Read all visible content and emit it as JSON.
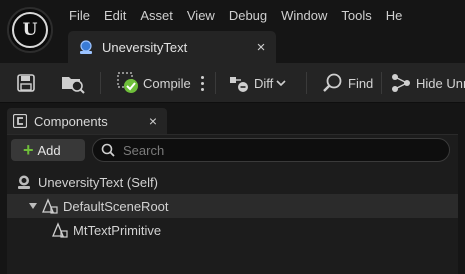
{
  "menu": {
    "items": [
      "File",
      "Edit",
      "Asset",
      "View",
      "Debug",
      "Window",
      "Tools",
      "He"
    ]
  },
  "document_tab": {
    "label": "UneversityText",
    "close": "×"
  },
  "toolbar": {
    "compile_label": "Compile",
    "diff_label": "Diff",
    "find_label": "Find",
    "hide_label": "Hide Unr"
  },
  "components_panel": {
    "title": "Components",
    "close": "×",
    "add_label": "Add",
    "search_placeholder": "Search",
    "tree": [
      {
        "label": "UneversityText (Self)"
      },
      {
        "label": "DefaultSceneRoot"
      },
      {
        "label": "MtTextPrimitive"
      }
    ]
  },
  "colors": {
    "background": "#151515",
    "panel": "#242424",
    "accent_green": "#6fbf3a",
    "blueprint_blue": "#3a7bd5"
  }
}
